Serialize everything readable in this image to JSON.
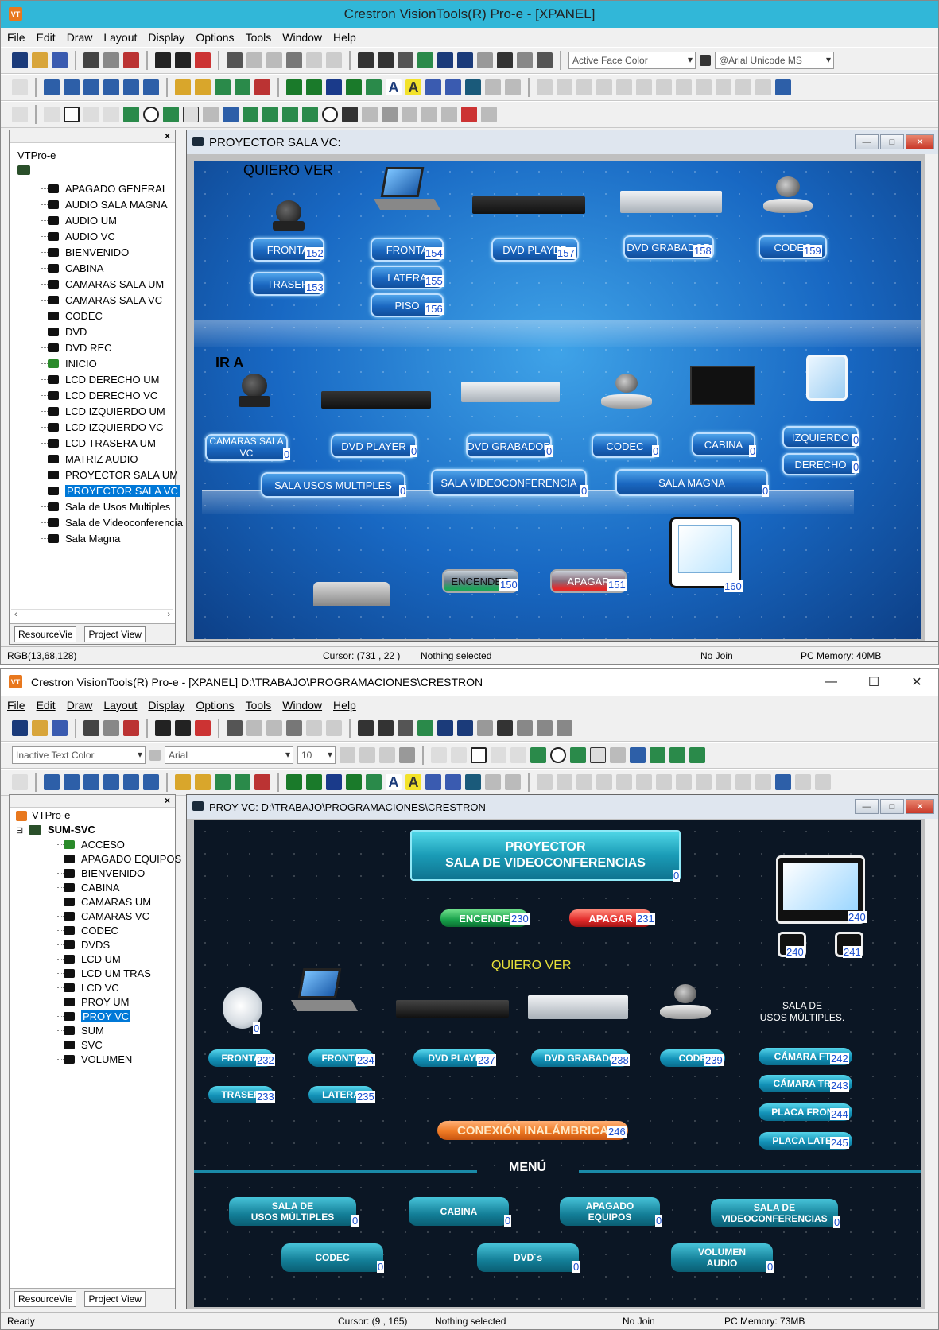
{
  "w1": {
    "title": "Crestron VisionTools(R) Pro-e - [XPANEL]",
    "menu": [
      "File",
      "Edit",
      "Draw",
      "Layout",
      "Display",
      "Options",
      "Tools",
      "Window",
      "Help"
    ],
    "combo_face": "Active Face Color",
    "combo_font": "@Arial Unicode MS",
    "tree_root": "VTPro-e",
    "tree_items": [
      "APAGADO GENERAL",
      "AUDIO SALA MAGNA",
      "AUDIO UM",
      "AUDIO VC",
      "BIENVENIDO",
      "CABINA",
      "CAMARAS SALA UM",
      "CAMARAS SALA VC",
      "CODEC",
      "DVD",
      "DVD REC",
      "INICIO",
      "LCD DERECHO UM",
      "LCD DERECHO VC",
      "LCD IZQUIERDO UM",
      "LCD IZQUIERDO VC",
      "LCD TRASERA UM",
      "MATRIZ AUDIO",
      "PROYECTOR SALA UM",
      "PROYECTOR SALA VC",
      "Sala de Usos Multiples",
      "Sala de Videoconferencia",
      "Sala Magna"
    ],
    "tab_resource": "ResourceVie",
    "tab_project": "Project View",
    "doc_title": "PROYECTOR SALA VC:",
    "quiero_ver": "QUIERO VER",
    "ir_a": "IR A",
    "btns_top": [
      {
        "label": "FRONTA",
        "join": "152"
      },
      {
        "label": "TRASER",
        "join": "153"
      },
      {
        "label": "FRONTA",
        "join": "154"
      },
      {
        "label": "LATERA",
        "join": "155"
      },
      {
        "label": "PISO",
        "join": "156"
      },
      {
        "label": "DVD PLAYER",
        "join": "157"
      },
      {
        "label": "DVD GRABADOR",
        "join": "158"
      },
      {
        "label": "CODEC",
        "join": "159"
      }
    ],
    "btns_ir": [
      {
        "label": "CAMARAS SALA VC",
        "join": "0"
      },
      {
        "label": "DVD PLAYER",
        "join": "0"
      },
      {
        "label": "DVD GRABADOR",
        "join": "0"
      },
      {
        "label": "CODEC",
        "join": "0"
      },
      {
        "label": "CABINA",
        "join": "0"
      },
      {
        "label": "IZQUIERDO",
        "join": "0"
      },
      {
        "label": "DERECHO",
        "join": "0"
      },
      {
        "label": "SALA USOS MULTIPLES",
        "join": "0"
      },
      {
        "label": "SALA VIDEOCONFERENCIA",
        "join": "0"
      },
      {
        "label": "SALA MAGNA",
        "join": "0"
      }
    ],
    "encender": {
      "label": "ENCENDER",
      "join": "150"
    },
    "apagar": {
      "label": "APAGAR",
      "join": "151"
    },
    "screen_join": "160",
    "status": {
      "rgb": "RGB(13,68,128)",
      "cursor": "Cursor: (731 , 22 )",
      "sel": "Nothing selected",
      "join": "No Join",
      "mem": "PC Memory: 40MB"
    }
  },
  "w2": {
    "title": "Crestron VisionTools(R) Pro-e - [XPANEL] D:\\TRABAJO\\PROGRAMACIONES\\CRESTRON",
    "menu": [
      "File",
      "Edit",
      "Draw",
      "Layout",
      "Display",
      "Options",
      "Tools",
      "Window",
      "Help"
    ],
    "combo_text": "Inactive Text Color",
    "combo_font": "Arial",
    "combo_size": "10",
    "tree_root": "VTPro-e",
    "tree_project": "SUM-SVC",
    "tree_items": [
      "ACCESO",
      "APAGADO EQUIPOS",
      "BIENVENIDO",
      "CABINA",
      "CAMARAS UM",
      "CAMARAS VC",
      "CODEC",
      "DVDS",
      "LCD UM",
      "LCD UM TRAS",
      "LCD VC",
      "PROY UM",
      "PROY VC",
      "SUM",
      "SVC",
      "VOLUMEN"
    ],
    "tab_resource": "ResourceVie",
    "tab_project": "Project View",
    "doc_title": "PROY VC: D:\\TRABAJO\\PROGRAMACIONES\\CRESTRON",
    "header_line1": "PROYECTOR",
    "header_line2": "SALA DE VIDEOCONFERENCIAS",
    "header_join": "0",
    "encender": {
      "label": "ENCENDE",
      "join": "230"
    },
    "apagar": {
      "label": "APAGAR",
      "join": "231"
    },
    "screen_joins": [
      "240",
      "240",
      "241"
    ],
    "quiero_ver": "QUIERO VER",
    "webcam_join": "0",
    "sum_line1": "SALA DE",
    "sum_line2": "USOS MÚLTIPLES.",
    "btns": [
      {
        "label": "FRONTA",
        "join": "232"
      },
      {
        "label": "TRASER",
        "join": "233"
      },
      {
        "label": "FRONTA",
        "join": "234"
      },
      {
        "label": "LATERA",
        "join": "235"
      },
      {
        "label": "DVD PLAYE",
        "join": "237"
      },
      {
        "label": "DVD GRABADO",
        "join": "238"
      },
      {
        "label": "CODE",
        "join": "239"
      },
      {
        "label": "CÁMARA FTA",
        "join": "242"
      },
      {
        "label": "CÁMARA TRA",
        "join": "243"
      },
      {
        "label": "PLACA FRONT",
        "join": "244"
      },
      {
        "label": "PLACA LATER",
        "join": "245"
      }
    ],
    "conexion": {
      "label": "CONEXIÓN INALÁMBRICA",
      "join": "246"
    },
    "menu_label": "MENÚ",
    "menu_btns": [
      {
        "l1": "SALA DE",
        "l2": "USOS MÚLTIPLES",
        "join": "0"
      },
      {
        "l1": "CABINA",
        "l2": "",
        "join": "0"
      },
      {
        "l1": "APAGADO",
        "l2": "EQUIPOS",
        "join": "0"
      },
      {
        "l1": "SALA DE",
        "l2": "VIDEOCONFERENCIAS",
        "join": "0"
      },
      {
        "l1": "CODEC",
        "l2": "",
        "join": "0"
      },
      {
        "l1": "DVD´s",
        "l2": "",
        "join": "0"
      },
      {
        "l1": "VOLUMEN",
        "l2": "AUDIO",
        "join": "0"
      }
    ],
    "status": {
      "ready": "Ready",
      "cursor": "Cursor: (9   , 165)",
      "sel": "Nothing selected",
      "join": "No Join",
      "mem": "PC Memory: 73MB"
    }
  }
}
